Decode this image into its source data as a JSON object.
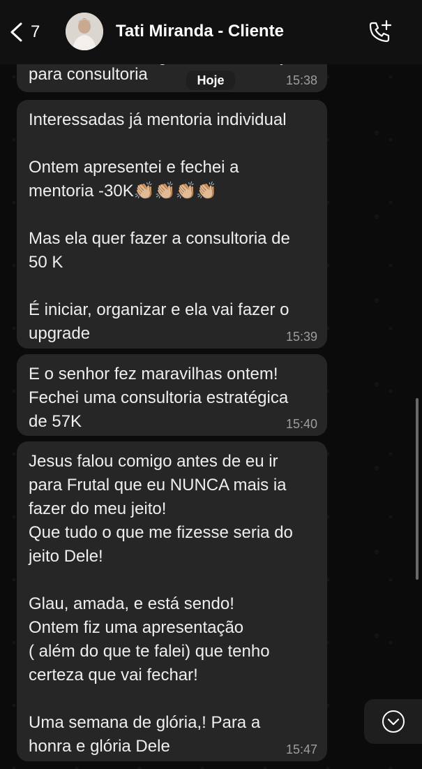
{
  "header": {
    "back_count": "7",
    "contact_name": "Tati Miranda - Cliente"
  },
  "date_divider": "Hoje",
  "messages": [
    {
      "text_partial": "Sai com duas mega interessadas já",
      "text_line2": "para consultoria",
      "time": "15:38"
    },
    {
      "text": "Interessadas já mentoria individual\n\nOntem apresentei e fechei a\nmentoria -30K👏🏼👏🏼👏🏼👏🏼\n\nMas ela quer fazer a consultoria de\n50 K\n\nÉ iniciar, organizar e ela vai fazer o\nupgrade",
      "time": "15:39"
    },
    {
      "text": "E o senhor fez maravilhas ontem!\nFechei uma consultoria estratégica\nde 57K",
      "time": "15:40"
    },
    {
      "text": "Jesus falou comigo antes de eu ir\npara Frutal que eu NUNCA mais ia\nfazer do meu jeito!\nQue tudo o que me fizesse seria do\njeito Dele!\n\nGlau, amada, e está sendo!\nOntem fiz uma apresentação\n( além do que te falei) que tenho\ncerteza que vai fechar!\n\nUma semana de glória,! Para a\nhonra e glória Dele",
      "time": "15:47"
    }
  ],
  "colors": {
    "bubble": "#262626",
    "background": "#0b0b0b",
    "text": "#eeeeee",
    "timestamp": "#9e9e9e"
  },
  "icons": [
    "chevron-left-icon",
    "avatar",
    "phone-add-icon",
    "chevron-down-icon"
  ]
}
